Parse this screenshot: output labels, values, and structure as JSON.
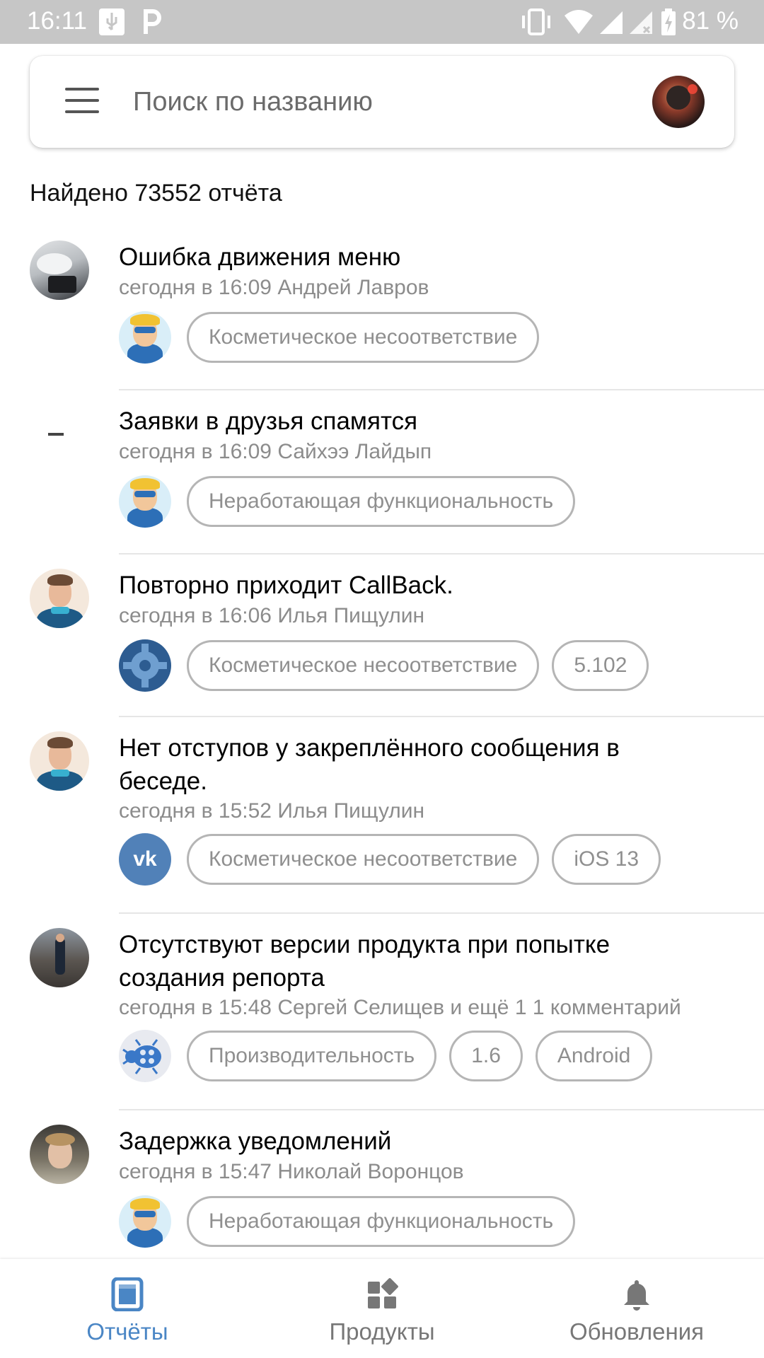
{
  "status_bar": {
    "time": "16:11",
    "battery": "81 %",
    "icons": [
      "usb-icon",
      "parking-app-icon",
      "vibrate-icon",
      "wifi-icon",
      "signal-icon",
      "signal-no-data-icon",
      "battery-charging-icon"
    ]
  },
  "search": {
    "placeholder": "Поиск по названию",
    "menu_icon": "hamburger-menu-icon",
    "profile_icon": "profile-avatar"
  },
  "found_text": "Найдено 73552 отчёта",
  "reports": [
    {
      "title": "Ошибка движения меню",
      "meta": "сегодня в 16:09 Андрей Лавров",
      "product_icon": "vk-hero-icon",
      "tags": [
        "Косметическое несоответствие"
      ]
    },
    {
      "title": "Заявки в друзья спамятся",
      "meta": "сегодня в 16:09 Сайхээ Лайдып",
      "product_icon": "vk-hero-icon",
      "tags": [
        "Неработающая функциональность"
      ]
    },
    {
      "title": "Повторно приходит CallBack.",
      "meta": "сегодня в 16:06 Илья Пищулин",
      "product_icon": "gear-icon",
      "tags": [
        "Косметическое несоответствие",
        "5.102"
      ]
    },
    {
      "title": "Нет отступов у закреплённого сообщения в беседе.",
      "meta": "сегодня в 15:52 Илья Пищулин",
      "product_icon": "vk-logo-icon",
      "product_icon_text": "vk",
      "tags": [
        "Косметическое несоответствие",
        "iOS 13"
      ]
    },
    {
      "title": "Отсутствуют версии продукта при попытке создания репорта",
      "meta": "сегодня в 15:48 Сергей Селищев и ещё 1 1 комментарий",
      "product_icon": "bug-icon",
      "tags": [
        "Производительность",
        "1.6",
        "Android"
      ]
    },
    {
      "title": "Задержка уведомлений",
      "meta": "сегодня в 15:47 Николай Воронцов",
      "product_icon": "vk-hero-icon",
      "tags": [
        "Неработающая функциональность"
      ]
    }
  ],
  "bottom_nav": [
    {
      "label": "Отчёты",
      "icon": "reports-icon",
      "active": true
    },
    {
      "label": "Продукты",
      "icon": "products-grid-icon",
      "active": false
    },
    {
      "label": "Обновления",
      "icon": "bell-icon",
      "active": false
    }
  ],
  "colors": {
    "accent": "#4a86c5",
    "tag_border": "#b5b5b5",
    "meta_text": "#8c8c8c",
    "status_bar": "#c6c6c6"
  }
}
